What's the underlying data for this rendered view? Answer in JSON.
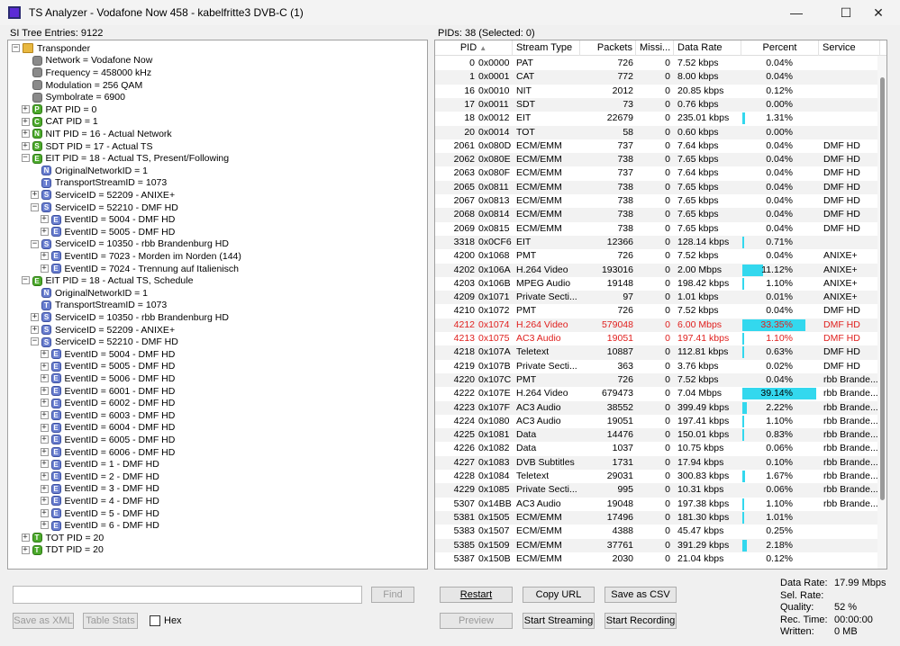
{
  "window": {
    "title": "TS Analyzer - Vodafone Now 458 - kabelfritte3 DVB-C (1)",
    "minimize": "—",
    "maximize": "☐",
    "close": "✕"
  },
  "left_header": "SI Tree Entries: 9122",
  "right_header": "PIDs: 38   (Selected: 0)",
  "tree": [
    {
      "t": "Transponder",
      "i": 0,
      "icon": "folder",
      "e": "-"
    },
    {
      "t": "Network = Vodafone Now",
      "i": 1,
      "icon": "gray",
      "e": ""
    },
    {
      "t": "Frequency = 458000 kHz",
      "i": 1,
      "icon": "gray",
      "e": ""
    },
    {
      "t": "Modulation = 256 QAM",
      "i": 1,
      "icon": "gray",
      "e": ""
    },
    {
      "t": "Symbolrate = 6900",
      "i": 1,
      "icon": "gray",
      "e": ""
    },
    {
      "t": "PAT PID = 0",
      "i": 1,
      "icon": "green",
      "l": "P",
      "e": "+"
    },
    {
      "t": "CAT PID = 1",
      "i": 1,
      "icon": "green",
      "l": "C",
      "e": "+"
    },
    {
      "t": "NIT PID = 16 - Actual Network",
      "i": 1,
      "icon": "green",
      "l": "N",
      "e": "+"
    },
    {
      "t": "SDT PID = 17 - Actual TS",
      "i": 1,
      "icon": "green",
      "l": "S",
      "e": "+"
    },
    {
      "t": "EIT PID = 18 - Actual TS, Present/Following",
      "i": 1,
      "icon": "green",
      "l": "E",
      "e": "-"
    },
    {
      "t": "OriginalNetworkID = 1",
      "i": 2,
      "icon": "blue",
      "l": "N",
      "e": ""
    },
    {
      "t": "TransportStreamID = 1073",
      "i": 2,
      "icon": "blue",
      "l": "T",
      "e": ""
    },
    {
      "t": "ServiceID = 52209 - ANIXE+",
      "i": 2,
      "icon": "blue",
      "l": "S",
      "e": "+"
    },
    {
      "t": "ServiceID = 52210 - DMF HD",
      "i": 2,
      "icon": "blue",
      "l": "S",
      "e": "-"
    },
    {
      "t": "EventID = 5004 - DMF HD",
      "i": 3,
      "icon": "blue",
      "l": "E",
      "e": "+"
    },
    {
      "t": "EventID = 5005 - DMF HD",
      "i": 3,
      "icon": "blue",
      "l": "E",
      "e": "+"
    },
    {
      "t": "ServiceID = 10350 - rbb Brandenburg HD",
      "i": 2,
      "icon": "blue",
      "l": "S",
      "e": "-"
    },
    {
      "t": "EventID = 7023 - Morden im Norden (144)",
      "i": 3,
      "icon": "blue",
      "l": "E",
      "e": "+"
    },
    {
      "t": "EventID = 7024 - Trennung auf Italienisch",
      "i": 3,
      "icon": "blue",
      "l": "E",
      "e": "+"
    },
    {
      "t": "EIT PID = 18 - Actual TS, Schedule",
      "i": 1,
      "icon": "green",
      "l": "E",
      "e": "-"
    },
    {
      "t": "OriginalNetworkID = 1",
      "i": 2,
      "icon": "blue",
      "l": "N",
      "e": ""
    },
    {
      "t": "TransportStreamID = 1073",
      "i": 2,
      "icon": "blue",
      "l": "T",
      "e": ""
    },
    {
      "t": "ServiceID = 10350 - rbb Brandenburg HD",
      "i": 2,
      "icon": "blue",
      "l": "S",
      "e": "+"
    },
    {
      "t": "ServiceID = 52209 - ANIXE+",
      "i": 2,
      "icon": "blue",
      "l": "S",
      "e": "+"
    },
    {
      "t": "ServiceID = 52210 - DMF HD",
      "i": 2,
      "icon": "blue",
      "l": "S",
      "e": "-"
    },
    {
      "t": "EventID = 5004 - DMF HD",
      "i": 3,
      "icon": "blue",
      "l": "E",
      "e": "+"
    },
    {
      "t": "EventID = 5005 - DMF HD",
      "i": 3,
      "icon": "blue",
      "l": "E",
      "e": "+"
    },
    {
      "t": "EventID = 5006 - DMF HD",
      "i": 3,
      "icon": "blue",
      "l": "E",
      "e": "+"
    },
    {
      "t": "EventID = 6001 - DMF HD",
      "i": 3,
      "icon": "blue",
      "l": "E",
      "e": "+"
    },
    {
      "t": "EventID = 6002 - DMF HD",
      "i": 3,
      "icon": "blue",
      "l": "E",
      "e": "+"
    },
    {
      "t": "EventID = 6003 - DMF HD",
      "i": 3,
      "icon": "blue",
      "l": "E",
      "e": "+"
    },
    {
      "t": "EventID = 6004 - DMF HD",
      "i": 3,
      "icon": "blue",
      "l": "E",
      "e": "+"
    },
    {
      "t": "EventID = 6005 - DMF HD",
      "i": 3,
      "icon": "blue",
      "l": "E",
      "e": "+"
    },
    {
      "t": "EventID = 6006 - DMF HD",
      "i": 3,
      "icon": "blue",
      "l": "E",
      "e": "+"
    },
    {
      "t": "EventID = 1 - DMF HD",
      "i": 3,
      "icon": "blue",
      "l": "E",
      "e": "+"
    },
    {
      "t": "EventID = 2 - DMF HD",
      "i": 3,
      "icon": "blue",
      "l": "E",
      "e": "+"
    },
    {
      "t": "EventID = 3 - DMF HD",
      "i": 3,
      "icon": "blue",
      "l": "E",
      "e": "+"
    },
    {
      "t": "EventID = 4 - DMF HD",
      "i": 3,
      "icon": "blue",
      "l": "E",
      "e": "+"
    },
    {
      "t": "EventID = 5 - DMF HD",
      "i": 3,
      "icon": "blue",
      "l": "E",
      "e": "+"
    },
    {
      "t": "EventID = 6 - DMF HD",
      "i": 3,
      "icon": "blue",
      "l": "E",
      "e": "+"
    },
    {
      "t": "TOT PID = 20",
      "i": 1,
      "icon": "green",
      "l": "T",
      "e": "+"
    },
    {
      "t": "TDT PID = 20",
      "i": 1,
      "icon": "green",
      "l": "T",
      "e": "+"
    }
  ],
  "columns": [
    "PID",
    "Stream Type",
    "Packets",
    "Missi...",
    "Data Rate",
    "Percent",
    "Service"
  ],
  "sort_icon": "▲",
  "rows": [
    {
      "pid": "0",
      "hex": "0x0000",
      "type": "PAT",
      "packets": "726",
      "miss": "0",
      "rate": "7.52 kbps",
      "pct": "0.04%",
      "p": 0.04,
      "svc": ""
    },
    {
      "pid": "1",
      "hex": "0x0001",
      "type": "CAT",
      "packets": "772",
      "miss": "0",
      "rate": "8.00 kbps",
      "pct": "0.04%",
      "p": 0.04,
      "svc": ""
    },
    {
      "pid": "16",
      "hex": "0x0010",
      "type": "NIT",
      "packets": "2012",
      "miss": "0",
      "rate": "20.85 kbps",
      "pct": "0.12%",
      "p": 0.12,
      "svc": ""
    },
    {
      "pid": "17",
      "hex": "0x0011",
      "type": "SDT",
      "packets": "73",
      "miss": "0",
      "rate": "0.76 kbps",
      "pct": "0.00%",
      "p": 0,
      "svc": ""
    },
    {
      "pid": "18",
      "hex": "0x0012",
      "type": "EIT",
      "packets": "22679",
      "miss": "0",
      "rate": "235.01 kbps",
      "pct": "1.31%",
      "p": 1.31,
      "svc": ""
    },
    {
      "pid": "20",
      "hex": "0x0014",
      "type": "TOT",
      "packets": "58",
      "miss": "0",
      "rate": "0.60 kbps",
      "pct": "0.00%",
      "p": 0,
      "svc": ""
    },
    {
      "pid": "2061",
      "hex": "0x080D",
      "type": "ECM/EMM",
      "packets": "737",
      "miss": "0",
      "rate": "7.64 kbps",
      "pct": "0.04%",
      "p": 0.04,
      "svc": "DMF HD"
    },
    {
      "pid": "2062",
      "hex": "0x080E",
      "type": "ECM/EMM",
      "packets": "738",
      "miss": "0",
      "rate": "7.65 kbps",
      "pct": "0.04%",
      "p": 0.04,
      "svc": "DMF HD"
    },
    {
      "pid": "2063",
      "hex": "0x080F",
      "type": "ECM/EMM",
      "packets": "737",
      "miss": "0",
      "rate": "7.64 kbps",
      "pct": "0.04%",
      "p": 0.04,
      "svc": "DMF HD"
    },
    {
      "pid": "2065",
      "hex": "0x0811",
      "type": "ECM/EMM",
      "packets": "738",
      "miss": "0",
      "rate": "7.65 kbps",
      "pct": "0.04%",
      "p": 0.04,
      "svc": "DMF HD"
    },
    {
      "pid": "2067",
      "hex": "0x0813",
      "type": "ECM/EMM",
      "packets": "738",
      "miss": "0",
      "rate": "7.65 kbps",
      "pct": "0.04%",
      "p": 0.04,
      "svc": "DMF HD"
    },
    {
      "pid": "2068",
      "hex": "0x0814",
      "type": "ECM/EMM",
      "packets": "738",
      "miss": "0",
      "rate": "7.65 kbps",
      "pct": "0.04%",
      "p": 0.04,
      "svc": "DMF HD"
    },
    {
      "pid": "2069",
      "hex": "0x0815",
      "type": "ECM/EMM",
      "packets": "738",
      "miss": "0",
      "rate": "7.65 kbps",
      "pct": "0.04%",
      "p": 0.04,
      "svc": "DMF HD"
    },
    {
      "pid": "3318",
      "hex": "0x0CF6",
      "type": "EIT",
      "packets": "12366",
      "miss": "0",
      "rate": "128.14 kbps",
      "pct": "0.71%",
      "p": 0.71,
      "svc": ""
    },
    {
      "pid": "4200",
      "hex": "0x1068",
      "type": "PMT",
      "packets": "726",
      "miss": "0",
      "rate": "7.52 kbps",
      "pct": "0.04%",
      "p": 0.04,
      "svc": "ANIXE+"
    },
    {
      "pid": "4202",
      "hex": "0x106A",
      "type": "H.264 Video",
      "packets": "193016",
      "miss": "0",
      "rate": "2.00 Mbps",
      "pct": "11.12%",
      "p": 11.12,
      "svc": "ANIXE+"
    },
    {
      "pid": "4203",
      "hex": "0x106B",
      "type": "MPEG Audio",
      "packets": "19148",
      "miss": "0",
      "rate": "198.42 kbps",
      "pct": "1.10%",
      "p": 1.1,
      "svc": "ANIXE+"
    },
    {
      "pid": "4209",
      "hex": "0x1071",
      "type": "Private Secti...",
      "packets": "97",
      "miss": "0",
      "rate": "1.01 kbps",
      "pct": "0.01%",
      "p": 0.01,
      "svc": "ANIXE+"
    },
    {
      "pid": "4210",
      "hex": "0x1072",
      "type": "PMT",
      "packets": "726",
      "miss": "0",
      "rate": "7.52 kbps",
      "pct": "0.04%",
      "p": 0.04,
      "svc": "DMF HD"
    },
    {
      "pid": "4212",
      "hex": "0x1074",
      "type": "H.264 Video",
      "packets": "579048",
      "miss": "0",
      "rate": "6.00 Mbps",
      "pct": "33.35%",
      "p": 33.35,
      "svc": "DMF HD",
      "red": true
    },
    {
      "pid": "4213",
      "hex": "0x1075",
      "type": "AC3 Audio",
      "packets": "19051",
      "miss": "0",
      "rate": "197.41 kbps",
      "pct": "1.10%",
      "p": 1.1,
      "svc": "DMF HD",
      "red": true
    },
    {
      "pid": "4218",
      "hex": "0x107A",
      "type": "Teletext",
      "packets": "10887",
      "miss": "0",
      "rate": "112.81 kbps",
      "pct": "0.63%",
      "p": 0.63,
      "svc": "DMF HD"
    },
    {
      "pid": "4219",
      "hex": "0x107B",
      "type": "Private Secti...",
      "packets": "363",
      "miss": "0",
      "rate": "3.76 kbps",
      "pct": "0.02%",
      "p": 0.02,
      "svc": "DMF HD"
    },
    {
      "pid": "4220",
      "hex": "0x107C",
      "type": "PMT",
      "packets": "726",
      "miss": "0",
      "rate": "7.52 kbps",
      "pct": "0.04%",
      "p": 0.04,
      "svc": "rbb Brande..."
    },
    {
      "pid": "4222",
      "hex": "0x107E",
      "type": "H.264 Video",
      "packets": "679473",
      "miss": "0",
      "rate": "7.04 Mbps",
      "pct": "39.14%",
      "p": 39.14,
      "svc": "rbb Brande..."
    },
    {
      "pid": "4223",
      "hex": "0x107F",
      "type": "AC3 Audio",
      "packets": "38552",
      "miss": "0",
      "rate": "399.49 kbps",
      "pct": "2.22%",
      "p": 2.22,
      "svc": "rbb Brande..."
    },
    {
      "pid": "4224",
      "hex": "0x1080",
      "type": "AC3 Audio",
      "packets": "19051",
      "miss": "0",
      "rate": "197.41 kbps",
      "pct": "1.10%",
      "p": 1.1,
      "svc": "rbb Brande..."
    },
    {
      "pid": "4225",
      "hex": "0x1081",
      "type": "Data",
      "packets": "14476",
      "miss": "0",
      "rate": "150.01 kbps",
      "pct": "0.83%",
      "p": 0.83,
      "svc": "rbb Brande..."
    },
    {
      "pid": "4226",
      "hex": "0x1082",
      "type": "Data",
      "packets": "1037",
      "miss": "0",
      "rate": "10.75 kbps",
      "pct": "0.06%",
      "p": 0.06,
      "svc": "rbb Brande..."
    },
    {
      "pid": "4227",
      "hex": "0x1083",
      "type": "DVB Subtitles",
      "packets": "1731",
      "miss": "0",
      "rate": "17.94 kbps",
      "pct": "0.10%",
      "p": 0.1,
      "svc": "rbb Brande..."
    },
    {
      "pid": "4228",
      "hex": "0x1084",
      "type": "Teletext",
      "packets": "29031",
      "miss": "0",
      "rate": "300.83 kbps",
      "pct": "1.67%",
      "p": 1.67,
      "svc": "rbb Brande..."
    },
    {
      "pid": "4229",
      "hex": "0x1085",
      "type": "Private Secti...",
      "packets": "995",
      "miss": "0",
      "rate": "10.31 kbps",
      "pct": "0.06%",
      "p": 0.06,
      "svc": "rbb Brande..."
    },
    {
      "pid": "5307",
      "hex": "0x14BB",
      "type": "AC3 Audio",
      "packets": "19048",
      "miss": "0",
      "rate": "197.38 kbps",
      "pct": "1.10%",
      "p": 1.1,
      "svc": "rbb Brande..."
    },
    {
      "pid": "5381",
      "hex": "0x1505",
      "type": "ECM/EMM",
      "packets": "17496",
      "miss": "0",
      "rate": "181.30 kbps",
      "pct": "1.01%",
      "p": 1.01,
      "svc": ""
    },
    {
      "pid": "5383",
      "hex": "0x1507",
      "type": "ECM/EMM",
      "packets": "4388",
      "miss": "0",
      "rate": "45.47 kbps",
      "pct": "0.25%",
      "p": 0.25,
      "svc": ""
    },
    {
      "pid": "5385",
      "hex": "0x1509",
      "type": "ECM/EMM",
      "packets": "37761",
      "miss": "0",
      "rate": "391.29 kbps",
      "pct": "2.18%",
      "p": 2.18,
      "svc": ""
    },
    {
      "pid": "5387",
      "hex": "0x150B",
      "type": "ECM/EMM",
      "packets": "2030",
      "miss": "0",
      "rate": "21.04 kbps",
      "pct": "0.12%",
      "p": 0.12,
      "svc": ""
    }
  ],
  "buttons": {
    "find": "Find",
    "save_xml": "Save as XML",
    "table_stats": "Table Stats",
    "hex": "Hex",
    "restart": "Restart",
    "copy_url": "Copy URL",
    "save_csv": "Save as CSV",
    "preview": "Preview",
    "start_streaming": "Start Streaming",
    "start_recording": "Start Recording"
  },
  "stats": [
    {
      "label": "Data Rate:",
      "value": "17.99 Mbps"
    },
    {
      "label": "Sel. Rate:",
      "value": ""
    },
    {
      "label": "Quality:",
      "value": "52 %"
    },
    {
      "label": "Rec. Time:",
      "value": "00:00:00"
    },
    {
      "label": "Written:",
      "value": "0 MB"
    }
  ],
  "colors": {
    "bar": "#33d8ee",
    "red_text": "#e0201e"
  }
}
